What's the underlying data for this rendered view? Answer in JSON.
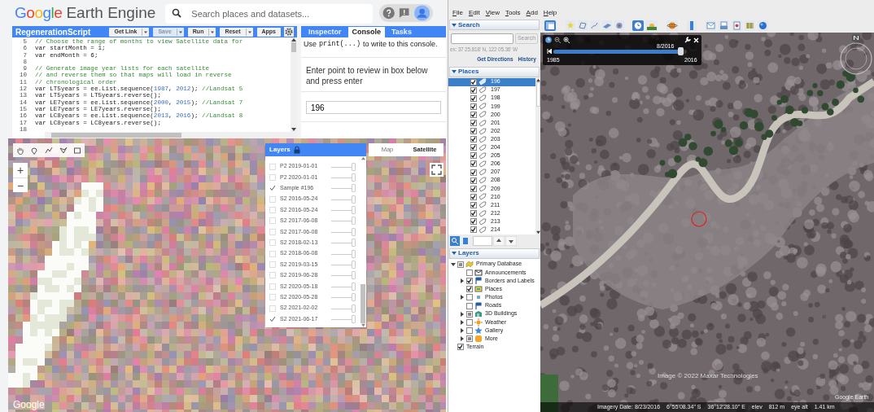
{
  "gee": {
    "logo": "Google",
    "product": "Earth Engine",
    "search_placeholder": "Search places and datasets...",
    "editor": {
      "title": "RegenerationScript",
      "buttons": [
        {
          "label": "Get Link",
          "disabled": false,
          "dropdown": true
        },
        {
          "label": "Save",
          "disabled": true,
          "dropdown": true
        },
        {
          "label": "Run",
          "disabled": false,
          "dropdown": true
        },
        {
          "label": "Reset",
          "disabled": false,
          "dropdown": true
        },
        {
          "label": "Apps",
          "disabled": false,
          "dropdown": false
        }
      ],
      "lines": [
        {
          "number": "5",
          "kind": "comment",
          "text": "// Choose the range of months to view Satellite data for"
        },
        {
          "number": "6",
          "kind": "code",
          "text": "var startMonth = 1;"
        },
        {
          "number": "7",
          "kind": "code",
          "text": "var endMonth = 6;"
        },
        {
          "number": "8",
          "kind": "blank"
        },
        {
          "number": "9",
          "kind": "comment",
          "text": "// Generate image year lists for each satellite"
        },
        {
          "number": "10",
          "kind": "comment",
          "text": "// and reverse them so that maps will load in reverse"
        },
        {
          "number": "11",
          "kind": "comment",
          "text": "// chronological order"
        },
        {
          "number": "12",
          "kind": "code",
          "text": "var LT5years = ee.List.sequence(1987, 2012); //Landsat 5"
        },
        {
          "number": "13",
          "kind": "code",
          "text": "var LT5years = LT5years.reverse();"
        },
        {
          "number": "14",
          "kind": "code",
          "text": "var LE7years = ee.List.sequence(2000, 2015); //Landsat 7"
        },
        {
          "number": "15",
          "kind": "code",
          "text": "var LE7years = LE7years.reverse();"
        },
        {
          "number": "16",
          "kind": "code",
          "text": "var LC8years = ee.List.sequence(2013, 2016); //Landsat 8"
        },
        {
          "number": "17",
          "kind": "code",
          "text": "var LC8years = LC8years.reverse();"
        },
        {
          "number": "18",
          "kind": "blank"
        }
      ]
    },
    "tabs": [
      {
        "label": "Inspector",
        "selected": false
      },
      {
        "label": "Console",
        "selected": true
      },
      {
        "label": "Tasks",
        "selected": false
      }
    ],
    "console": {
      "hint_before": "Use",
      "hint_code": "print(...)",
      "hint_after": "to write to this console.",
      "prompt": "Enter point to review in box below and press enter",
      "value": "196"
    },
    "map": {
      "layers_title": "Layers",
      "layers": [
        {
          "label": "P2 2019-01-01",
          "checked": false,
          "level": 1
        },
        {
          "label": "P2 2020-01-01",
          "checked": false,
          "level": 1
        },
        {
          "label": "Sample #196",
          "checked": true,
          "level": 1
        },
        {
          "label": "S2 2016-05-24",
          "checked": false,
          "level": 1
        },
        {
          "label": "S2 2016-05-24",
          "checked": false,
          "level": 1
        },
        {
          "label": "S2 2017-06-08",
          "checked": false,
          "level": 1
        },
        {
          "label": "S2 2017-06-08",
          "checked": false,
          "level": 1
        },
        {
          "label": "S2 2018-02-13",
          "checked": false,
          "level": 1
        },
        {
          "label": "S2 2018-06-08",
          "checked": false,
          "level": 1
        },
        {
          "label": "S2 2019-03-15",
          "checked": false,
          "level": 1
        },
        {
          "label": "S2 2019-06-28",
          "checked": false,
          "level": 1
        },
        {
          "label": "S2 2020-05-18",
          "checked": false,
          "level": 1
        },
        {
          "label": "S2 2020-05-28",
          "checked": false,
          "level": 1
        },
        {
          "label": "S2 2021-02-02",
          "checked": false,
          "level": 1
        },
        {
          "label": "S2 2021-06-17",
          "checked": true,
          "level": 1
        }
      ],
      "map_types": [
        {
          "label": "Map",
          "selected": false
        },
        {
          "label": "Satellite",
          "selected": true
        }
      ],
      "zoom_in": "+",
      "zoom_out": "−",
      "attribution": "Google"
    }
  },
  "earth": {
    "menu": [
      "File",
      "Edit",
      "View",
      "Tools",
      "Add",
      "Help"
    ],
    "search": {
      "title": "Search",
      "button": "Search",
      "hint": "ex: 37 25.818' N, 122 05.36' W",
      "links": [
        "Get Directions",
        "History"
      ]
    },
    "places": {
      "title": "Places",
      "items": [
        {
          "label": "196",
          "checked": true,
          "selected": true
        },
        {
          "label": "197",
          "checked": true,
          "selected": false
        },
        {
          "label": "198",
          "checked": true,
          "selected": false
        },
        {
          "label": "199",
          "checked": true,
          "selected": false
        },
        {
          "label": "200",
          "checked": true,
          "selected": false
        },
        {
          "label": "201",
          "checked": true,
          "selected": false
        },
        {
          "label": "202",
          "checked": true,
          "selected": false
        },
        {
          "label": "203",
          "checked": true,
          "selected": false
        },
        {
          "label": "204",
          "checked": true,
          "selected": false
        },
        {
          "label": "205",
          "checked": true,
          "selected": false
        },
        {
          "label": "206",
          "checked": true,
          "selected": false
        },
        {
          "label": "207",
          "checked": true,
          "selected": false
        },
        {
          "label": "208",
          "checked": true,
          "selected": false
        },
        {
          "label": "209",
          "checked": true,
          "selected": false
        },
        {
          "label": "210",
          "checked": true,
          "selected": false
        },
        {
          "label": "211",
          "checked": true,
          "selected": false
        },
        {
          "label": "212",
          "checked": true,
          "selected": false
        },
        {
          "label": "213",
          "checked": true,
          "selected": false
        },
        {
          "label": "214",
          "checked": true,
          "selected": false
        }
      ]
    },
    "layers": {
      "title": "Layers",
      "tree": [
        {
          "label": "Primary Database",
          "checked": false,
          "mixed": true,
          "expanded": true,
          "children": [
            {
              "label": "Announcements",
              "checked": false,
              "mixed": false
            },
            {
              "label": "Borders and Labels",
              "checked": true,
              "mixed": false,
              "expanded": false
            },
            {
              "label": "Places",
              "checked": true,
              "mixed": false
            },
            {
              "label": "Photos",
              "checked": false,
              "mixed": false,
              "expanded": false
            },
            {
              "label": "Roads",
              "checked": false,
              "mixed": false
            },
            {
              "label": "3D Buildings",
              "checked": false,
              "mixed": true,
              "expanded": false
            },
            {
              "label": "Weather",
              "checked": false,
              "mixed": false,
              "expanded": false
            },
            {
              "label": "Gallery",
              "checked": false,
              "mixed": false,
              "expanded": false
            },
            {
              "label": "More",
              "checked": false,
              "mixed": true,
              "expanded": false
            }
          ]
        },
        {
          "label": "Terrain",
          "checked": true,
          "mixed": false
        }
      ]
    },
    "timeline": {
      "current": "8/2016",
      "start": "1985",
      "end": "2016",
      "level": 0.95
    },
    "attribution": "Image © 2022 Maxar Technologies",
    "brand": "Google Earth",
    "status": [
      "Imagery Date: 8/23/2016",
      "6°55'08.34\" S",
      "36°12'28.10\" E",
      "elev",
      "812 m",
      "eye alt",
      "1.41 km"
    ]
  }
}
